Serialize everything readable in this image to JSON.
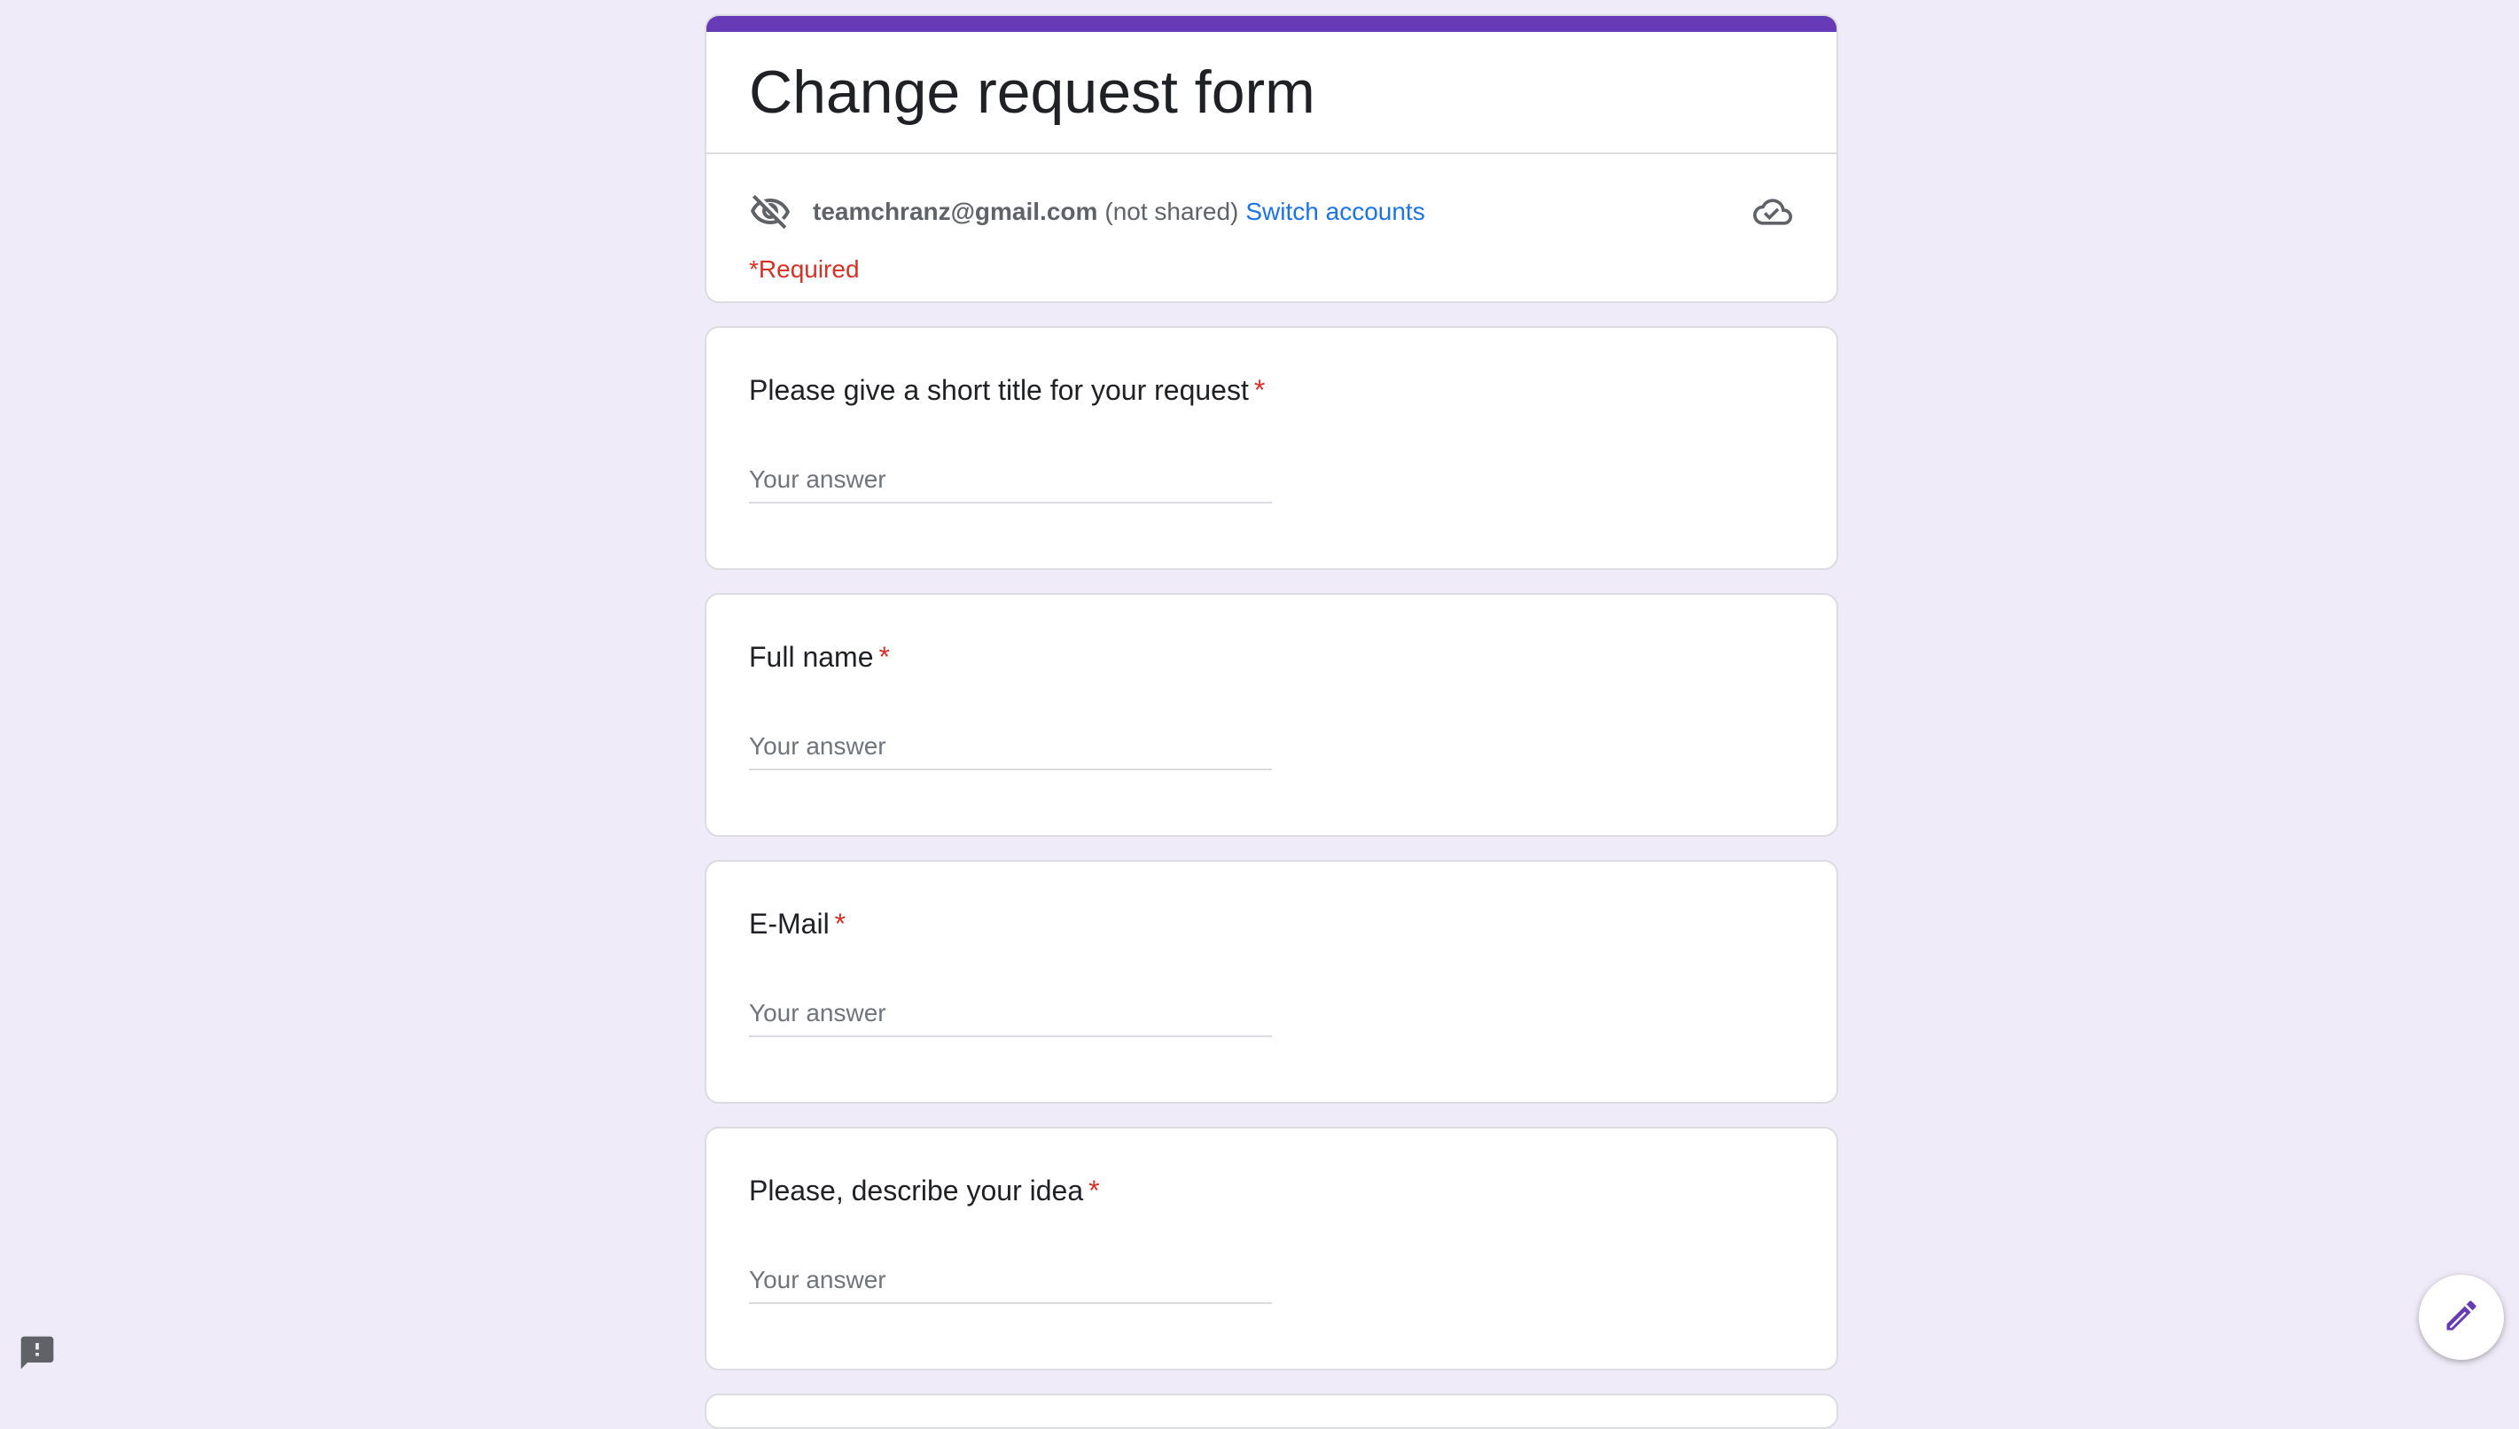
{
  "form": {
    "title": "Change request form",
    "accent_color": "#673ab7",
    "background_color": "#f0ebf8"
  },
  "account": {
    "email": "teamchranz@gmail.com",
    "sharing_status": "(not shared)",
    "switch_label": "Switch accounts",
    "visibility_icon": "eye-off-icon",
    "sync_icon": "cloud-done-icon"
  },
  "required_note": "*Required",
  "questions": [
    {
      "title": "Please give a short title for your request",
      "required_mark": "*",
      "placeholder": "Your answer"
    },
    {
      "title": "Full name",
      "required_mark": "*",
      "placeholder": "Your answer"
    },
    {
      "title": "E-Mail",
      "required_mark": "*",
      "placeholder": "Your answer"
    },
    {
      "title": "Please, describe your idea",
      "required_mark": "*",
      "placeholder": "Your answer"
    }
  ],
  "icons": {
    "feedback": "report-feedback-icon",
    "edit": "pencil-icon"
  }
}
